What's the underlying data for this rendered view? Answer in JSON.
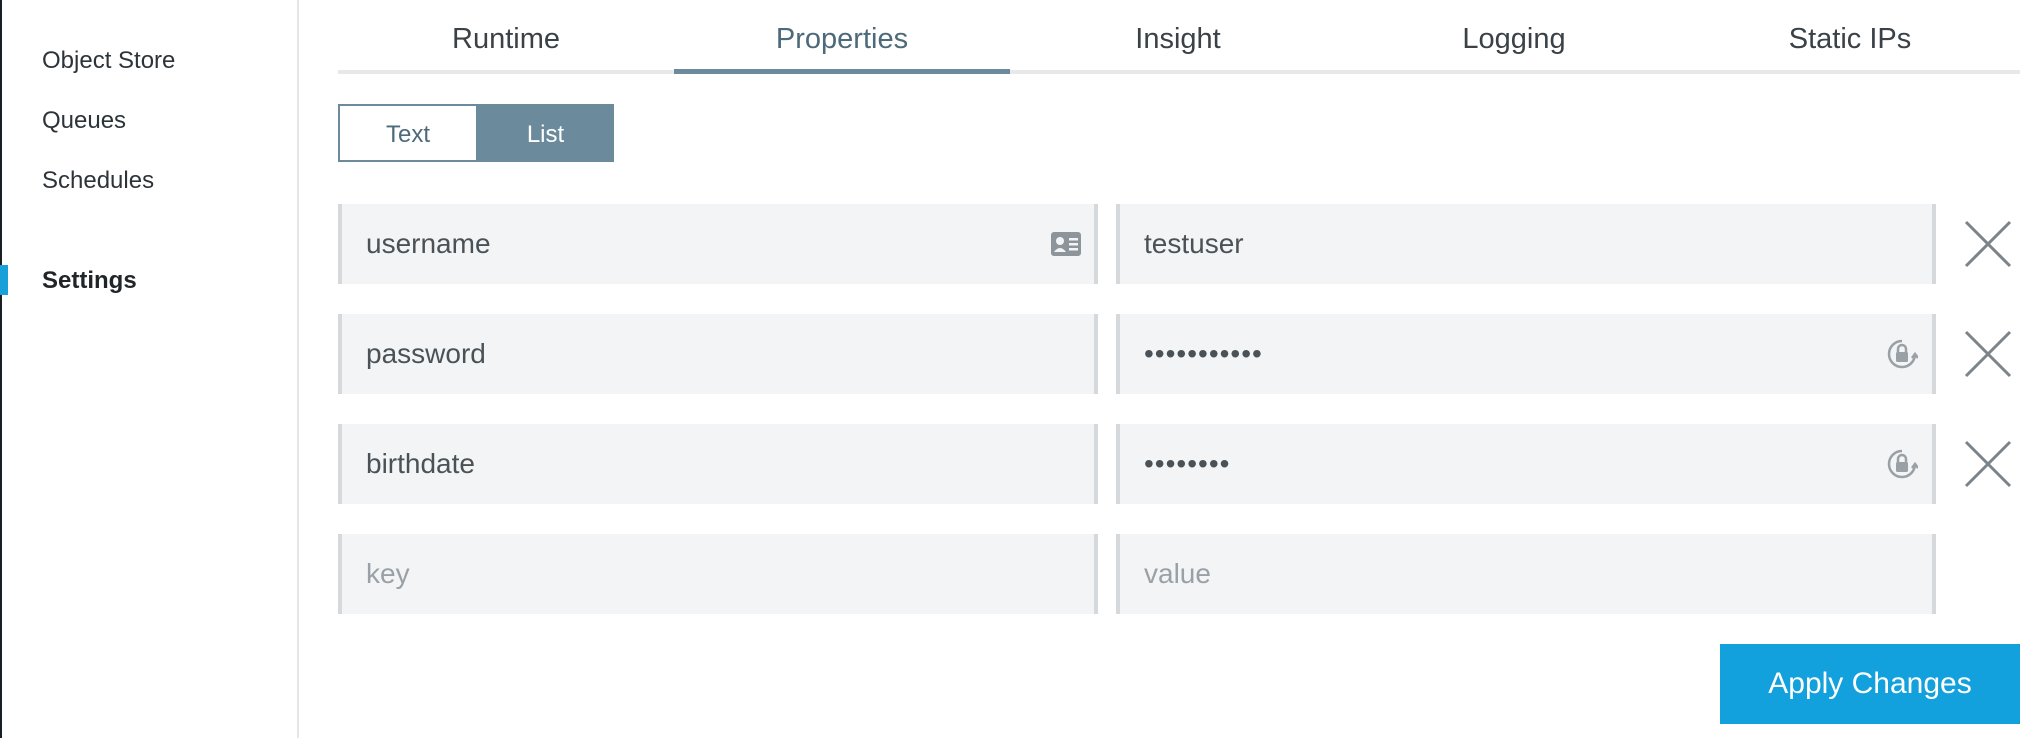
{
  "sidebar": {
    "items": [
      {
        "label": "Object Store"
      },
      {
        "label": "Queues"
      },
      {
        "label": "Schedules"
      },
      {
        "label": "Settings",
        "active": true
      }
    ]
  },
  "tabs": [
    {
      "label": "Runtime"
    },
    {
      "label": "Properties",
      "active": true
    },
    {
      "label": "Insight"
    },
    {
      "label": "Logging"
    },
    {
      "label": "Static IPs"
    }
  ],
  "view_toggle": {
    "text_label": "Text",
    "list_label": "List",
    "selected": "List"
  },
  "properties": [
    {
      "key": "username",
      "value": "testuser",
      "key_icon": "contact-card-icon",
      "secure": false
    },
    {
      "key": "password",
      "value": "•••••••••••",
      "value_icon": "secure-lock-icon",
      "secure": true
    },
    {
      "key": "birthdate",
      "value": "••••••••",
      "value_icon": "secure-lock-icon",
      "secure": true
    }
  ],
  "new_property": {
    "key_placeholder": "key",
    "value_placeholder": "value"
  },
  "apply_button": {
    "label": "Apply Changes"
  },
  "colors": {
    "accent": "#12a1dc",
    "toggle_active": "#6b8a9b",
    "active_tab_text": "#4d6a7a",
    "field_bg": "#f3f4f5"
  }
}
